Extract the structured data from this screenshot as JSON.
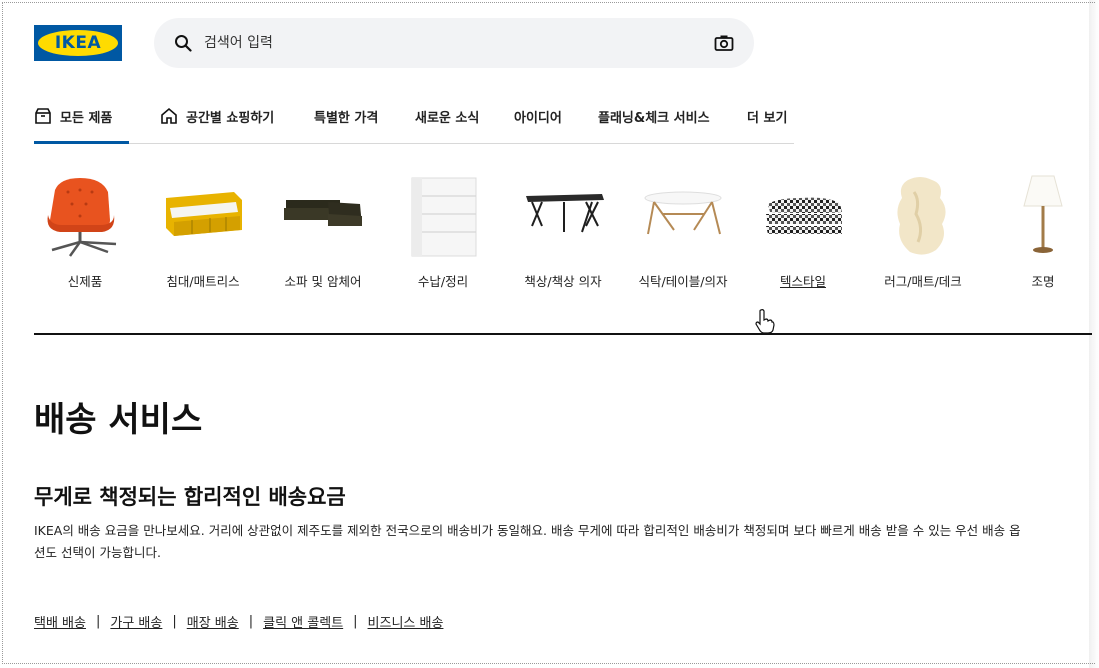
{
  "header": {
    "logo_text": "IKEA",
    "search_placeholder": "검색어 입력"
  },
  "nav": {
    "items": [
      {
        "label": "모든 제품",
        "icon": "box-icon",
        "active": true
      },
      {
        "label": "공간별 쇼핑하기",
        "icon": "home-icon",
        "active": false
      },
      {
        "label": "특별한 가격",
        "active": false
      },
      {
        "label": "새로운 소식",
        "active": false
      },
      {
        "label": "아이디어",
        "active": false
      },
      {
        "label": "플래닝&체크 서비스",
        "active": false
      },
      {
        "label": "더 보기",
        "active": false
      }
    ]
  },
  "categories": [
    {
      "label": "신제품",
      "image": "armchair"
    },
    {
      "label": "침대/매트리스",
      "image": "daybed"
    },
    {
      "label": "소파 및 암체어",
      "image": "sofa"
    },
    {
      "label": "수납/정리",
      "image": "dresser"
    },
    {
      "label": "책상/책상 의자",
      "image": "desk"
    },
    {
      "label": "식탁/테이블/의자",
      "image": "table"
    },
    {
      "label": "텍스타일",
      "image": "textiles",
      "hovered": true
    },
    {
      "label": "러그/매트/데크",
      "image": "rug"
    },
    {
      "label": "조명",
      "image": "lamp"
    }
  ],
  "content": {
    "title": "배송 서비스",
    "subtitle": "무게로 책정되는 합리적인 배송요금",
    "description": "IKEA의 배송 요금을 만나보세요. 거리에 상관없이 제주도를 제외한 전국으로의 배송비가 동일해요. 배송 무게에 따라 합리적인 배송비가 책정되며 보다 빠르게 배송 받을 수 있는 우선 배송 옵션도 선택이 가능합니다.",
    "links": [
      "택배 배송",
      "가구 배송",
      "매장 배송",
      "클릭 앤 콜렉트",
      "비즈니스 배송"
    ],
    "separator": "|"
  },
  "colors": {
    "brand_blue": "#0058a3",
    "brand_yellow": "#ffdb00",
    "search_bg": "#f2f3f5"
  }
}
